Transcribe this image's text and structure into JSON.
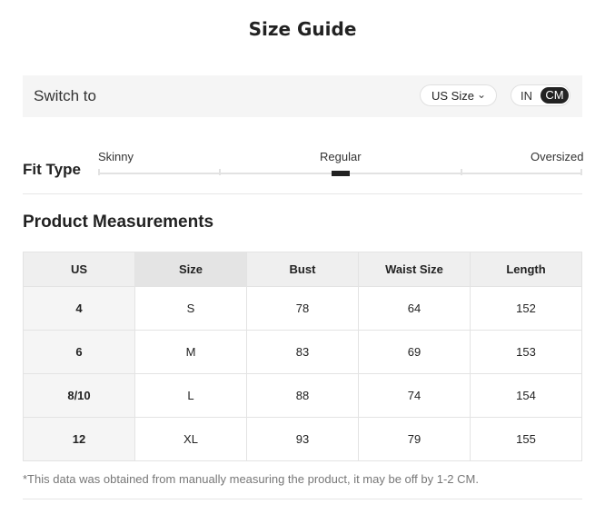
{
  "page": {
    "title": "Size Guide"
  },
  "switch_bar": {
    "label": "Switch to",
    "size_system": "US Size",
    "units": {
      "in": "IN",
      "cm": "CM",
      "selected": "CM"
    }
  },
  "fit_type": {
    "label": "Fit Type",
    "options": [
      "Skinny",
      "Regular",
      "Oversized"
    ],
    "selected": "Regular"
  },
  "measurements": {
    "title": "Product Measurements",
    "columns": [
      "US",
      "Size",
      "Bust",
      "Waist Size",
      "Length"
    ],
    "selected_column": "Size",
    "rows": [
      [
        "4",
        "S",
        "78",
        "64",
        "152"
      ],
      [
        "6",
        "M",
        "83",
        "69",
        "153"
      ],
      [
        "8/10",
        "L",
        "88",
        "74",
        "154"
      ],
      [
        "12",
        "XL",
        "93",
        "79",
        "155"
      ]
    ]
  },
  "note": "*This data was obtained from manually measuring the product, it may be off by 1-2 CM.",
  "colors": {
    "accent": "#222222",
    "panel": "#f5f5f5",
    "border": "#e3e3e3"
  },
  "icons": {
    "size_dropdown": "chevron-down-icon"
  }
}
